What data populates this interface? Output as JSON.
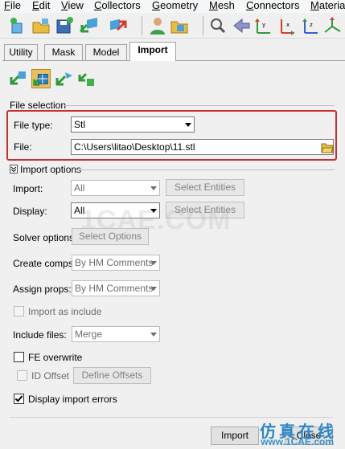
{
  "menu": [
    "File",
    "Edit",
    "View",
    "Collectors",
    "Geometry",
    "Mesh",
    "Connectors",
    "Materia"
  ],
  "toolbar_icons": [
    "new-model-icon",
    "open-model-icon",
    "save-model-icon",
    "import-icon",
    "export-icon",
    "user-profile-icon",
    "options-icon",
    "zoom-icon",
    "back-icon",
    "view-xz-icon",
    "view-yx-icon",
    "view-zy-icon",
    "view-iso-icon"
  ],
  "tabs": [
    "Utility",
    "Mask",
    "Model",
    "Import"
  ],
  "active_tab": "Import",
  "import_type_icons": [
    "import-model-icon",
    "import-geometry-icon",
    "import-solver-deck-icon",
    "import-connectors-icon"
  ],
  "file_selection": {
    "header": "File selection",
    "file_type_label": "File type:",
    "file_type_value": "Stl",
    "file_label": "File:",
    "file_value": "C:\\Users\\litao\\Desktop\\11.stl"
  },
  "import_options": {
    "header": "Import options",
    "import_label": "Import:",
    "import_value": "All",
    "select_entities_label": "Select Entities",
    "display_label": "Display:",
    "display_value": "All",
    "solver_options_label": "Solver options:",
    "select_options_label": "Select Options",
    "create_comps_label": "Create comps:",
    "create_comps_value": "By HM Comments",
    "assign_props_label": "Assign props:",
    "assign_props_value": "By HM Comments",
    "import_as_include_label": "Import as include",
    "include_files_label": "Include files:",
    "include_files_value": "Merge",
    "fe_overwrite_label": "FE overwrite",
    "id_offset_label": "ID Offset",
    "define_offsets_label": "Define Offsets",
    "display_import_errors_label": "Display import errors",
    "fe_overwrite_checked": false,
    "id_offset_checked": false,
    "import_as_include_checked": false,
    "display_import_errors_checked": true
  },
  "watermark": "1CAE.COM",
  "import_button_label": "Import",
  "close_button_label": "Close",
  "brand_cn": "仿真在线",
  "brand_url": "www.1CAE.com",
  "colors": {
    "highlight": "#c43030",
    "brand": "#2f86c4"
  }
}
